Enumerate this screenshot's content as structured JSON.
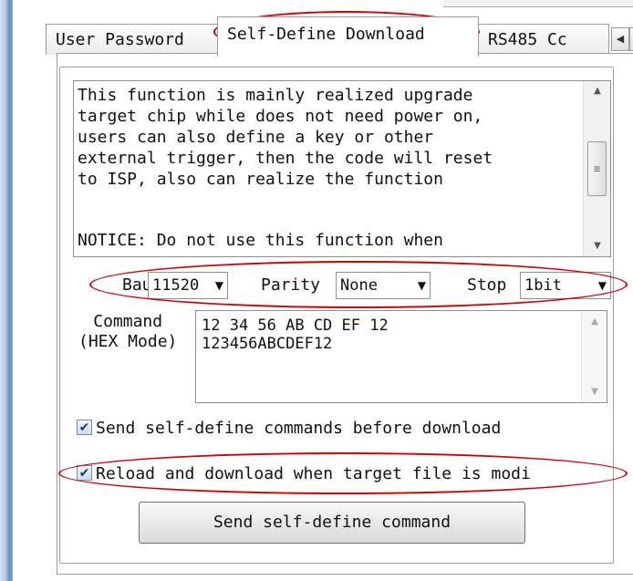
{
  "tabs": [
    {
      "label": "User Password"
    },
    {
      "label": "Self-Define Download"
    },
    {
      "label": "RS485 Cc"
    }
  ],
  "tab_scroll": {
    "left_icon": "left-arrow-icon",
    "right_icon": "right-arrow-icon"
  },
  "description": {
    "text": "This function is mainly realized upgrade\ntarget chip while does not need power on,\nusers can also define a key or other\nexternal trigger, then the code will reset\nto ISP, also can realize the function",
    "notice": "NOTICE: Do not use this function when"
  },
  "serial": {
    "baud_label": "Baud",
    "baud_value": "11520",
    "parity_label": "Parity",
    "parity_value": "None",
    "stop_label": "Stop",
    "stop_value": "1bit"
  },
  "command": {
    "label": "Command\n(HEX Mode)",
    "value": "12 34 56 AB CD EF 12\n123456ABCDEF12"
  },
  "options": [
    {
      "label": "Send self-define commands before download",
      "checked": true
    },
    {
      "label": "Reload and download when target file is modi",
      "checked": true
    }
  ],
  "send_button_label": "Send self-define command",
  "accent_colors": {
    "annotation": "#d20000",
    "checkbox": "#1c3c7a"
  }
}
